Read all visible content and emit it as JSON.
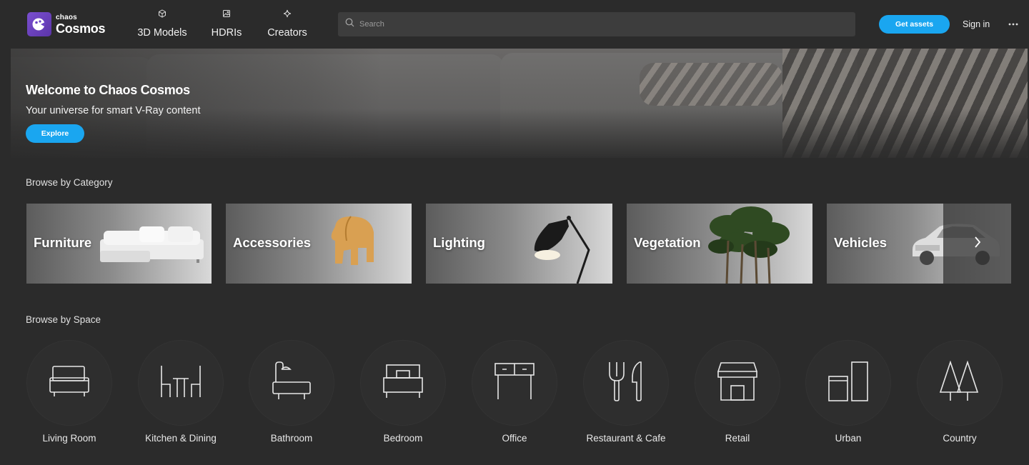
{
  "brand": {
    "small": "chaos",
    "big": "Cosmos"
  },
  "nav": [
    {
      "label": "3D Models",
      "icon": "cube-icon"
    },
    {
      "label": "HDRIs",
      "icon": "image-icon"
    },
    {
      "label": "Creators",
      "icon": "sparkle-icon"
    }
  ],
  "search": {
    "placeholder": "Search"
  },
  "header_actions": {
    "get_assets": "Get assets",
    "sign_in": "Sign in"
  },
  "hero": {
    "title": "Welcome to Chaos Cosmos",
    "subtitle": "Your universe for smart V-Ray content",
    "cta": "Explore"
  },
  "browse_category": {
    "title": "Browse by Category",
    "items": [
      {
        "label": "Furniture"
      },
      {
        "label": "Accessories"
      },
      {
        "label": "Lighting"
      },
      {
        "label": "Vegetation"
      },
      {
        "label": "Vehicles"
      }
    ]
  },
  "browse_space": {
    "title": "Browse by Space",
    "items": [
      {
        "label": "Living Room",
        "icon": "sofa-icon"
      },
      {
        "label": "Kitchen & Dining",
        "icon": "dining-table-icon"
      },
      {
        "label": "Bathroom",
        "icon": "bathtub-icon"
      },
      {
        "label": "Bedroom",
        "icon": "bed-icon"
      },
      {
        "label": "Office",
        "icon": "desk-icon"
      },
      {
        "label": "Restaurant & Cafe",
        "icon": "fork-knife-icon"
      },
      {
        "label": "Retail",
        "icon": "storefront-icon"
      },
      {
        "label": "Urban",
        "icon": "buildings-icon"
      },
      {
        "label": "Country",
        "icon": "trees-icon"
      }
    ]
  },
  "colors": {
    "accent": "#1aa6f0",
    "background": "#2b2b2b",
    "brand_purple": "#6b44c4"
  }
}
